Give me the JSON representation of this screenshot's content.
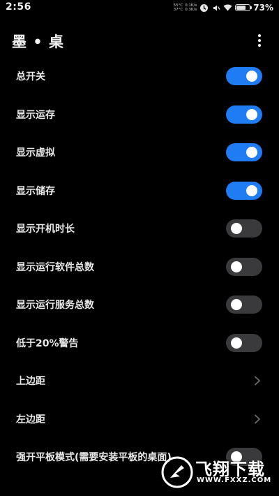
{
  "status_bar": {
    "time": "2:56",
    "temp_cpu": "55°C",
    "temp_battery": "37°C",
    "net_up": "0.1K/s",
    "net_down": "0.3K/s",
    "battery_percent": "73%",
    "battery_level": 0.73,
    "icons": [
      "alarm-icon",
      "mute-icon",
      "wifi-icon",
      "battery-icon"
    ]
  },
  "app_bar": {
    "title": "墨 • 桌",
    "menu_icon": "overflow-menu-icon"
  },
  "settings": {
    "items": [
      {
        "label": "总开关",
        "type": "toggle",
        "on": true
      },
      {
        "label": "显示运存",
        "type": "toggle",
        "on": true
      },
      {
        "label": "显示虚拟",
        "type": "toggle",
        "on": true
      },
      {
        "label": "显示储存",
        "type": "toggle",
        "on": true
      },
      {
        "label": "显示开机时长",
        "type": "toggle",
        "on": false
      },
      {
        "label": "显示运行软件总数",
        "type": "toggle",
        "on": false
      },
      {
        "label": "显示运行服务总数",
        "type": "toggle",
        "on": false
      },
      {
        "label": "低于20%警告",
        "type": "toggle",
        "on": false
      },
      {
        "label": "上边距",
        "type": "chevron"
      },
      {
        "label": "左边距",
        "type": "chevron"
      },
      {
        "label": "强开平板模式(需要安装平板的桌面)",
        "type": "toggle",
        "on": false
      }
    ]
  },
  "colors": {
    "background": "#000000",
    "toggle_on": "#1f7cf2",
    "toggle_off": "#3a3a3c",
    "text": "#e8e8e8"
  },
  "watermark": {
    "brand": "飞翔下载",
    "url": "WWW.FXXZ.COM"
  }
}
